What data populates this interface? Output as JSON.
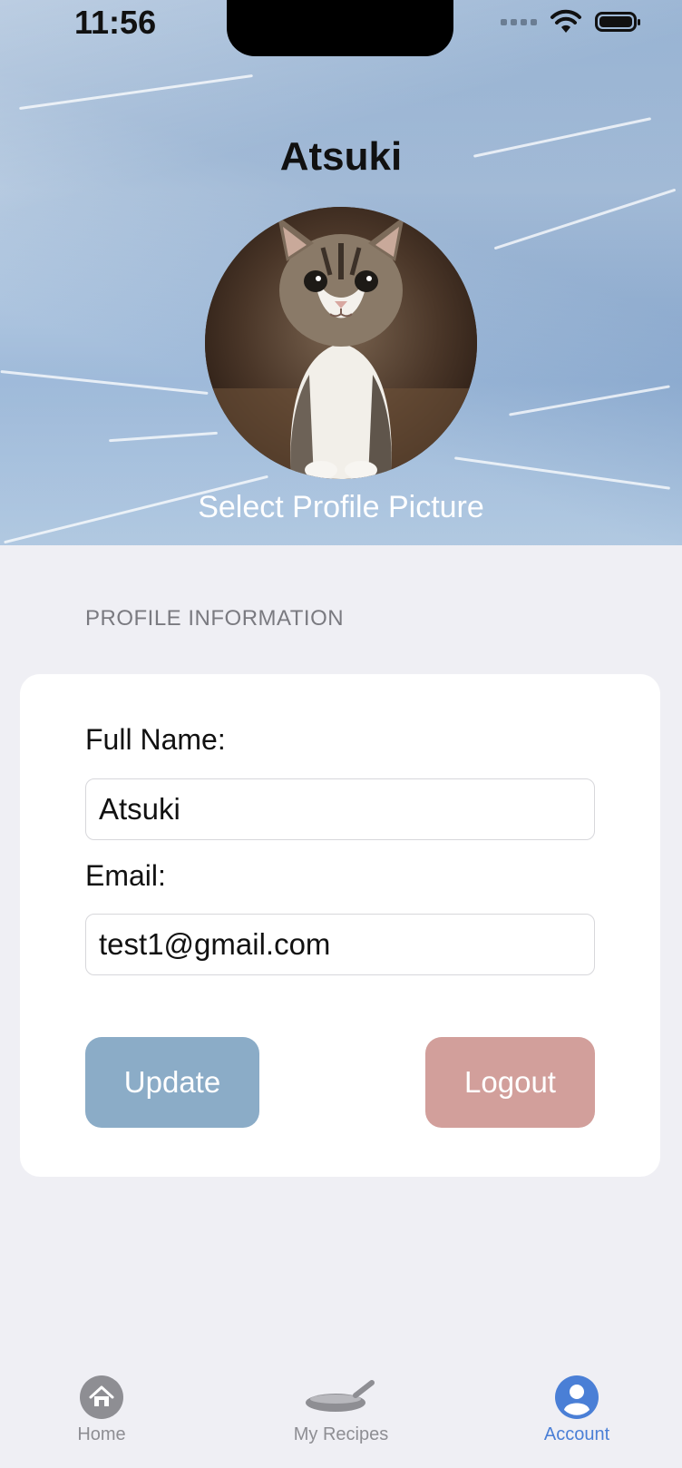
{
  "status_bar": {
    "time": "11:56"
  },
  "header": {
    "title": "Atsuki",
    "select_picture": "Select Profile Picture"
  },
  "profile_section": {
    "label": "PROFILE INFORMATION"
  },
  "form": {
    "full_name_label": "Full Name:",
    "full_name_value": "Atsuki",
    "email_label": "Email:",
    "email_value": "test1@gmail.com"
  },
  "buttons": {
    "update": "Update",
    "logout": "Logout"
  },
  "tabs": [
    {
      "label": "Home",
      "icon": "house-icon",
      "active": false
    },
    {
      "label": "My Recipes",
      "icon": "pan-icon",
      "active": false
    },
    {
      "label": "Account",
      "icon": "person-icon",
      "active": true
    }
  ],
  "colors": {
    "update_button": "#8bacc7",
    "logout_button": "#d29f9b",
    "tab_active": "#4a7fd6",
    "tab_inactive": "#8e8e93",
    "background": "#efeff4"
  }
}
